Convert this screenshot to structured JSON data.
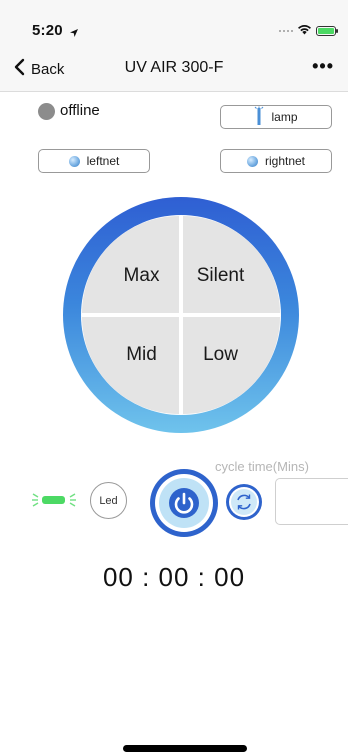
{
  "statusbar": {
    "time": "5:20",
    "icons": [
      "location-arrow-icon",
      "signal-icon",
      "wifi-icon",
      "battery-charging-icon"
    ],
    "battery_color": "#4cd964"
  },
  "nav": {
    "back_label": "Back",
    "title": "UV AIR 300-F",
    "more_label": "•••"
  },
  "device": {
    "status_text": "offline",
    "status_color": "#8c8c8c"
  },
  "toggles": {
    "lamp_label": "lamp",
    "leftnet_label": "leftnet",
    "rightnet_label": "rightnet"
  },
  "modes": {
    "top_left": "Max",
    "top_right": "Silent",
    "bottom_left": "Mid",
    "bottom_right": "Low"
  },
  "controls": {
    "cycle_time_label": "cycle time(Mins)",
    "led_label": "Led",
    "led_indicator_color": "#4cd964",
    "cycle_input_value": "",
    "accent_color": "#2e63cc"
  },
  "timer": {
    "display": "00 : 00 : 00"
  }
}
